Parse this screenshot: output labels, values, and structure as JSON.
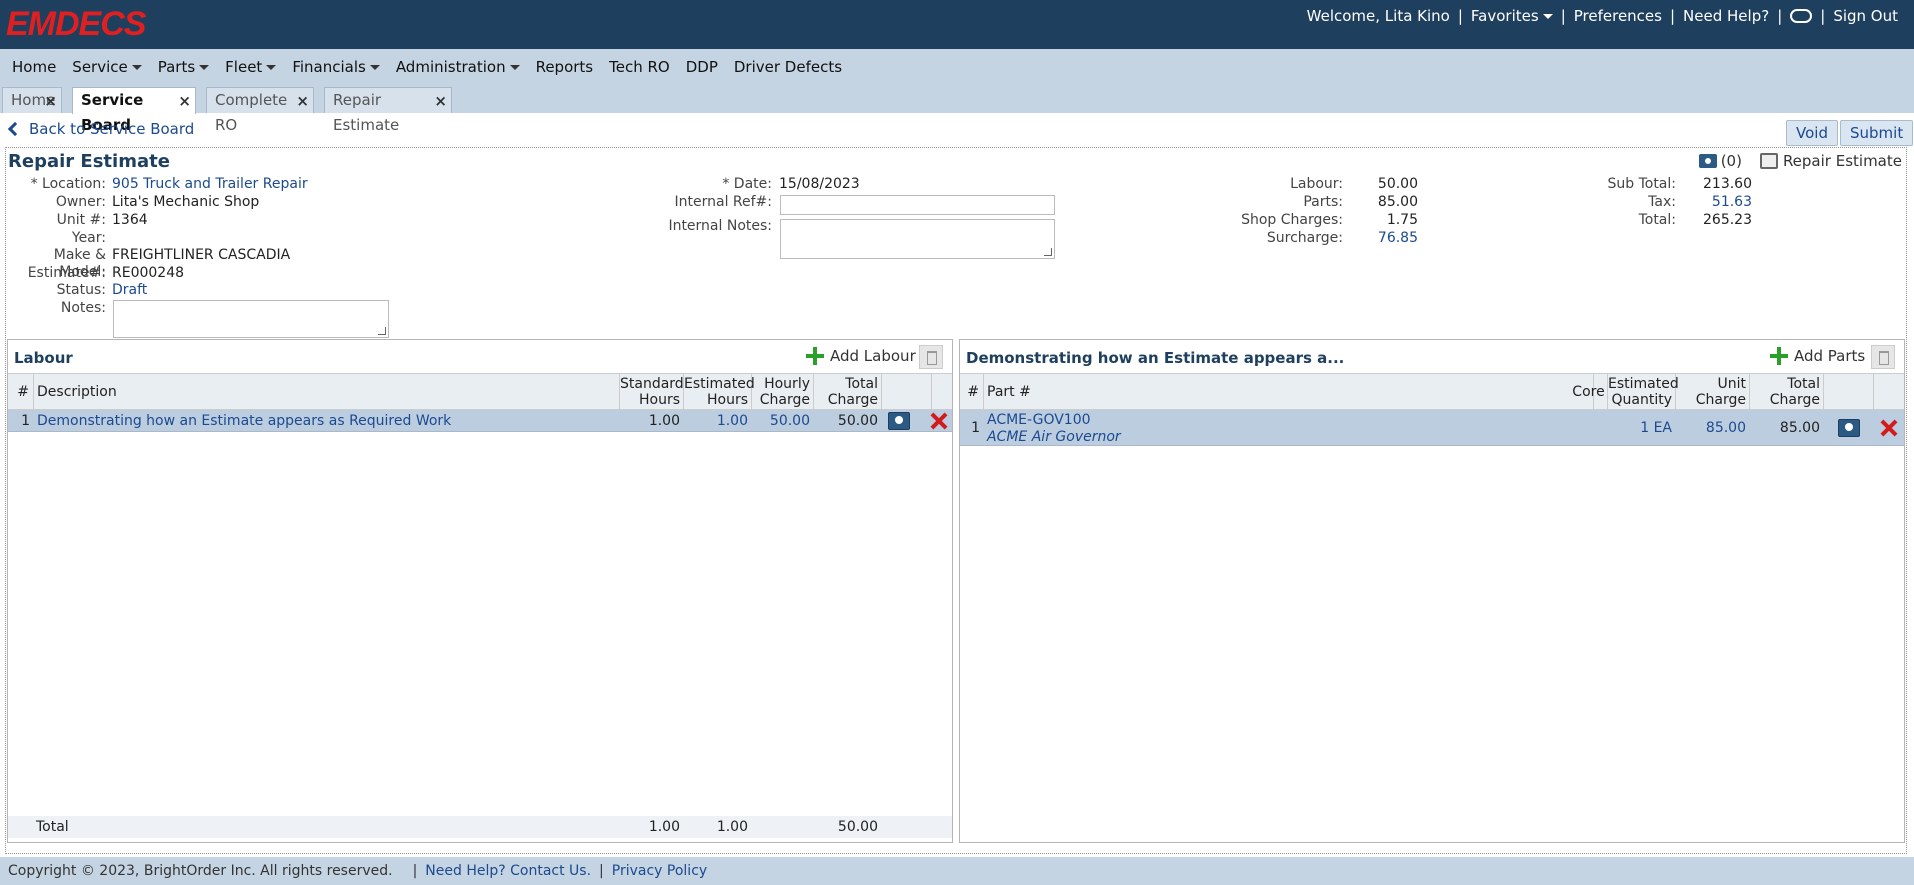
{
  "brand": {
    "logo_text": "EMDECS",
    "logo_color": "#e02020"
  },
  "topbar": {
    "welcome": "Welcome, Lita Kino",
    "favorites": "Favorites",
    "preferences": "Preferences",
    "need_help": "Need Help?",
    "sign_out": "Sign Out"
  },
  "menu": {
    "home": "Home",
    "service": "Service",
    "parts": "Parts",
    "fleet": "Fleet",
    "financials": "Financials",
    "administration": "Administration",
    "reports": "Reports",
    "tech_ro": "Tech RO",
    "ddp": "DDP",
    "driver_defects": "Driver Defects"
  },
  "tabs": [
    {
      "label": "Home"
    },
    {
      "label": "Service Board"
    },
    {
      "label": "Complete RO"
    },
    {
      "label": "Repair Estimate"
    }
  ],
  "actions": {
    "back": "Back to Service Board",
    "void": "Void",
    "submit": "Submit"
  },
  "header": {
    "title": "Repair Estimate",
    "attachment_count": "(0)",
    "print_label": "Repair Estimate"
  },
  "details": {
    "location_label": "* Location:",
    "location": "905 Truck and Trailer Repair",
    "owner_label": "Owner:",
    "owner": "Lita's Mechanic Shop",
    "unit_label": "Unit #:",
    "unit": "1364",
    "year_label": "Year:",
    "year": "",
    "make_label": "Make & Model:",
    "make": "FREIGHTLINER CASCADIA",
    "estimate_label": "Estimate#:",
    "estimate": "RE000248",
    "status_label": "Status:",
    "status": "Draft",
    "notes_label": "Notes:"
  },
  "meta": {
    "date_label": "* Date:",
    "date": "15/08/2023",
    "ref_label": "Internal Ref#:",
    "ref": "",
    "notes_label": "Internal Notes:"
  },
  "totals": {
    "labour_label": "Labour:",
    "labour": "50.00",
    "parts_label": "Parts:",
    "parts": "85.00",
    "shop_label": "Shop Charges:",
    "shop": "1.75",
    "surcharge_label": "Surcharge:",
    "surcharge": "76.85",
    "subtotal_label": "Sub Total:",
    "subtotal": "213.60",
    "tax_label": "Tax:",
    "tax": "51.63",
    "total_label": "Total:",
    "total": "265.23"
  },
  "labour": {
    "title": "Labour",
    "add": "Add Labour",
    "columns": {
      "num": "#",
      "desc": "Description",
      "std": "Standard Hours",
      "est": "Estimated Hours",
      "rate": "Hourly Charge",
      "total": "Total Charge"
    },
    "rows": [
      {
        "num": "1",
        "desc": "Demonstrating how an Estimate appears as Required Work",
        "std": "1.00",
        "est": "1.00",
        "rate": "50.00",
        "total": "50.00"
      }
    ],
    "footer": {
      "label": "Total",
      "std": "1.00",
      "est": "1.00",
      "total": "50.00"
    }
  },
  "parts": {
    "title": "Demonstrating how an Estimate appears a...",
    "add": "Add Parts",
    "columns": {
      "num": "#",
      "part": "Part #",
      "core": "Core",
      "qty": "Estimated Quantity",
      "unit": "Unit Charge",
      "total": "Total Charge"
    },
    "rows": [
      {
        "num": "1",
        "part": "ACME-GOV100",
        "part_desc": "ACME Air Governor",
        "core": "",
        "qty": "1 EA",
        "unit": "85.00",
        "total": "85.00"
      }
    ]
  },
  "footer": {
    "copyright": "Copyright © 2023, BrightOrder Inc. All rights reserved.",
    "contact": "Need Help? Contact Us.",
    "privacy": "Privacy Policy"
  }
}
